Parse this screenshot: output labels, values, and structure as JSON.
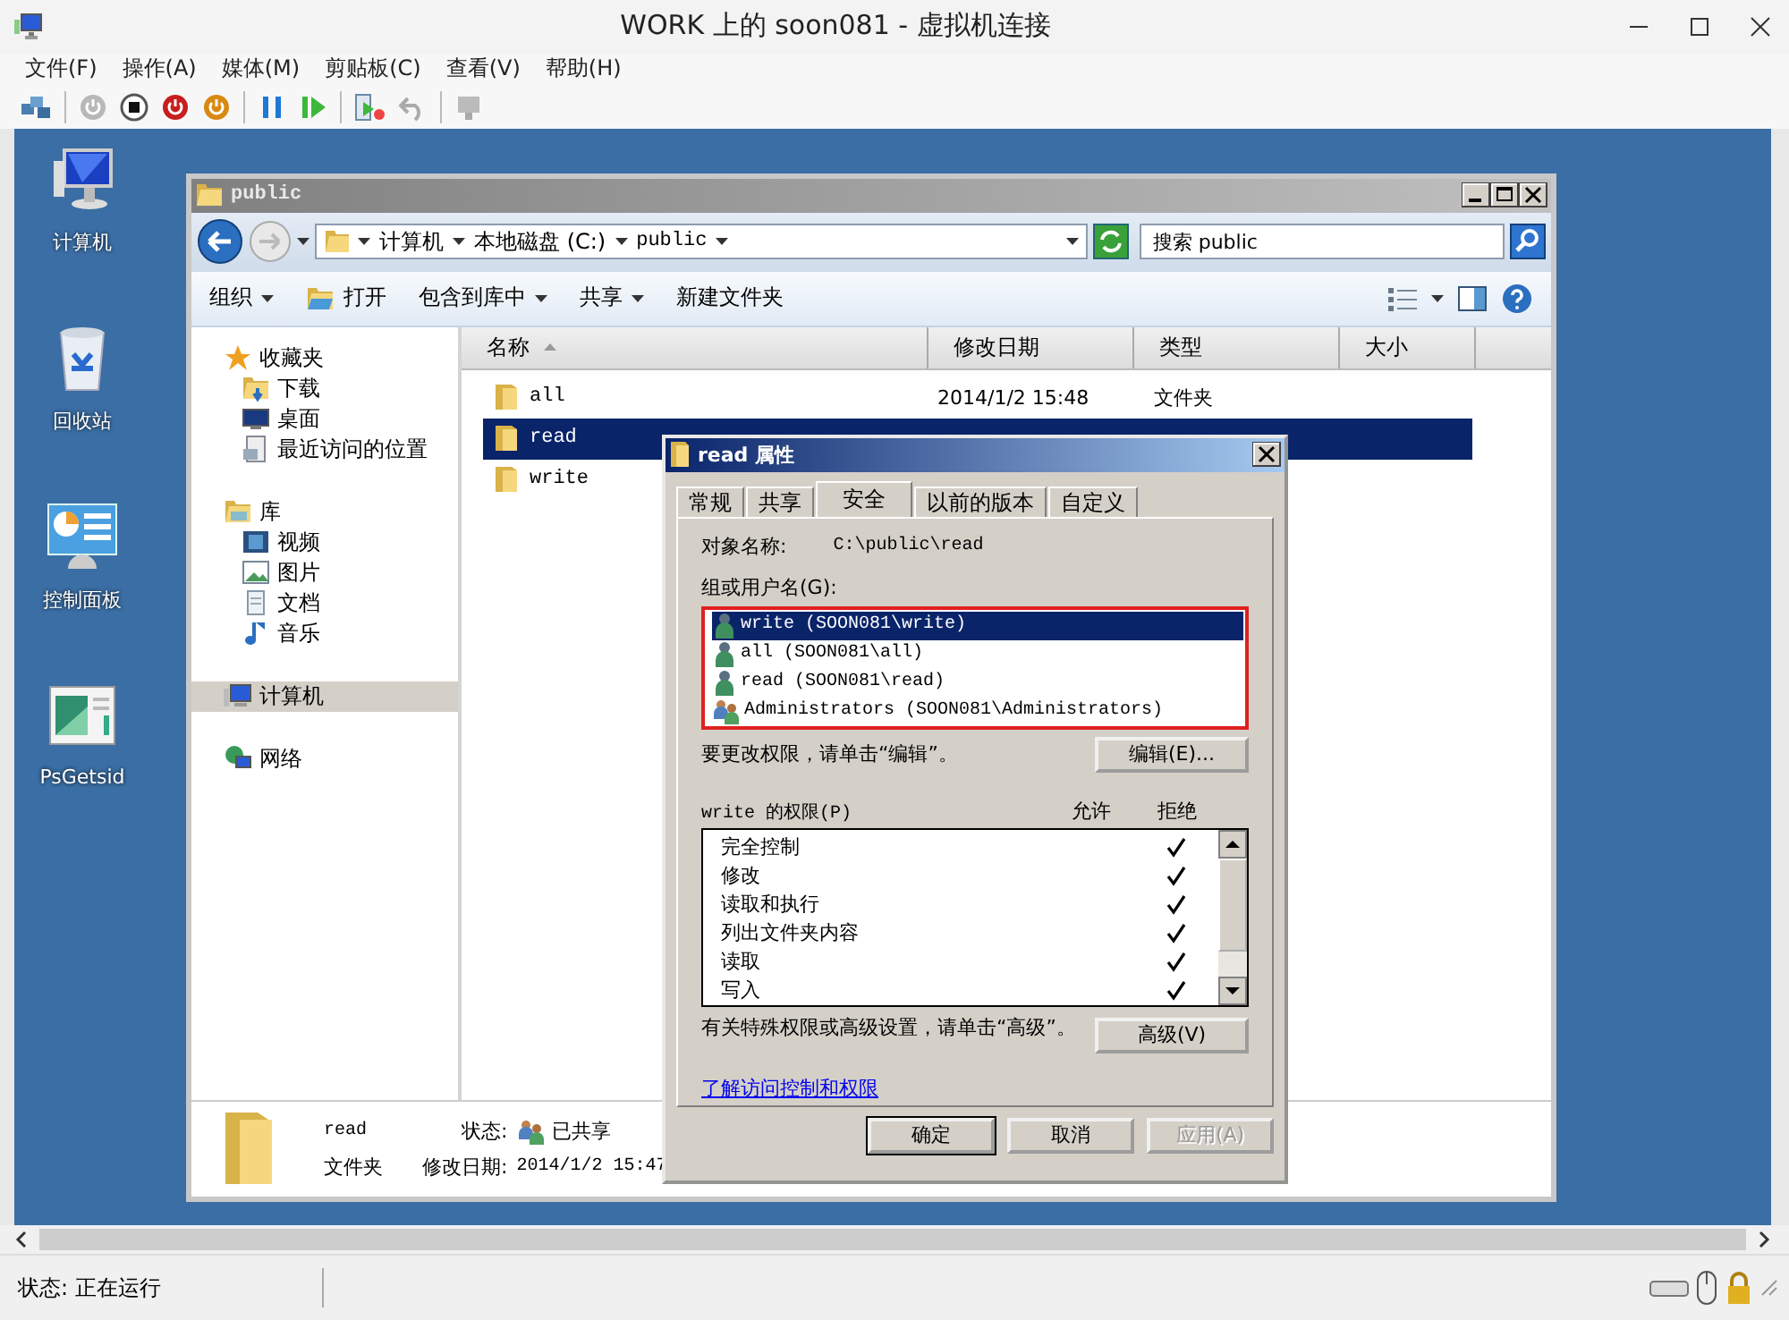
{
  "window": {
    "title": "WORK 上的 soon081 - 虚拟机连接"
  },
  "menu": [
    "文件(F)",
    "操作(A)",
    "媒体(M)",
    "剪贴板(C)",
    "查看(V)",
    "帮助(H)"
  ],
  "desktop_icons": [
    {
      "label": "计算机",
      "kind": "computer"
    },
    {
      "label": "回收站",
      "kind": "recycle-bin"
    },
    {
      "label": "控制面板",
      "kind": "control-panel"
    },
    {
      "label": "PsGetsid",
      "kind": "program"
    }
  ],
  "explorer": {
    "title": "public",
    "breadcrumb": [
      "计算机",
      "本地磁盘 (C:)",
      "public"
    ],
    "search": {
      "placeholder": "搜索 public"
    },
    "commands": [
      {
        "label": "组织",
        "has_icon": false,
        "dropdown": true
      },
      {
        "label": "打开",
        "has_icon": true,
        "dropdown": false
      },
      {
        "label": "包含到库中",
        "has_icon": false,
        "dropdown": true
      },
      {
        "label": "共享",
        "has_icon": false,
        "dropdown": true
      },
      {
        "label": "新建文件夹",
        "has_icon": false,
        "dropdown": false
      }
    ],
    "nav": [
      {
        "label": "收藏夹",
        "kind": "favorites",
        "selected": false,
        "children": [
          {
            "label": "下载",
            "kind": "downloads",
            "selected": false
          },
          {
            "label": "桌面",
            "kind": "desktop",
            "selected": false
          },
          {
            "label": "最近访问的位置",
            "kind": "recent",
            "selected": false
          }
        ]
      },
      {
        "label": "库",
        "kind": "library",
        "selected": false,
        "children": [
          {
            "label": "视频",
            "kind": "video",
            "selected": false
          },
          {
            "label": "图片",
            "kind": "pictures",
            "selected": false
          },
          {
            "label": "文档",
            "kind": "documents",
            "selected": false
          },
          {
            "label": "音乐",
            "kind": "music",
            "selected": false
          }
        ]
      },
      {
        "label": "计算机",
        "kind": "computer",
        "selected": true
      },
      {
        "label": "网络",
        "kind": "network",
        "selected": false
      }
    ],
    "columns": [
      {
        "label": "名称",
        "sorted": true
      },
      {
        "label": "修改日期",
        "sorted": false
      },
      {
        "label": "类型",
        "sorted": false
      },
      {
        "label": "大小",
        "sorted": false
      }
    ],
    "rows": [
      {
        "name": "all",
        "modified": "2014/1/2 15:48",
        "type": "文件夹",
        "selected": false
      },
      {
        "name": "read",
        "selected": true
      },
      {
        "name": "write",
        "selected": false
      }
    ],
    "details": {
      "name": "read",
      "type": "文件夹",
      "status_label": "状态:",
      "status": "已共享",
      "modified_label": "修改日期:",
      "modified": "2014/1/2 15:47"
    }
  },
  "dialog": {
    "title": "read 属性",
    "tabs": [
      {
        "label": "常规",
        "selected": false
      },
      {
        "label": "共享",
        "selected": false
      },
      {
        "label": "安全",
        "selected": true
      },
      {
        "label": "以前的版本",
        "selected": false
      },
      {
        "label": "自定义",
        "selected": false
      }
    ],
    "object_label": "对象名称:",
    "object_name": "C:\\public\\read",
    "principals_label": "组或用户名(G):",
    "principals": [
      {
        "name": "write (SOON081\\write)",
        "kind": "user",
        "selected": true
      },
      {
        "name": "all (SOON081\\all)",
        "kind": "user",
        "selected": false
      },
      {
        "name": "read (SOON081\\read)",
        "kind": "user",
        "selected": false
      },
      {
        "name": "Administrators (SOON081\\Administrators)",
        "kind": "group",
        "selected": false
      }
    ],
    "edit_hint": "要更改权限，请单击“编辑”。",
    "edit_button": "编辑(E)...",
    "permissions_label": "write 的权限(P)",
    "allow_header": "允许",
    "deny_header": "拒绝",
    "permissions": [
      {
        "name": "完全控制",
        "allow": false,
        "deny": true
      },
      {
        "name": "修改",
        "allow": false,
        "deny": true
      },
      {
        "name": "读取和执行",
        "allow": false,
        "deny": true
      },
      {
        "name": "列出文件夹内容",
        "allow": false,
        "deny": true
      },
      {
        "name": "读取",
        "allow": false,
        "deny": true
      },
      {
        "name": "写入",
        "allow": false,
        "deny": true
      }
    ],
    "advanced_hint": "有关特殊权限或高级设置，请单击“高级”。",
    "advanced_button": "高级(V)",
    "link": "了解访问控制和权限",
    "buttons": [
      {
        "label": "确定",
        "default": true,
        "disabled": false
      },
      {
        "label": "取消",
        "default": false,
        "disabled": false
      },
      {
        "label": "应用(A)",
        "default": false,
        "disabled": true
      }
    ]
  },
  "status_bar": "状态: 正在运行"
}
